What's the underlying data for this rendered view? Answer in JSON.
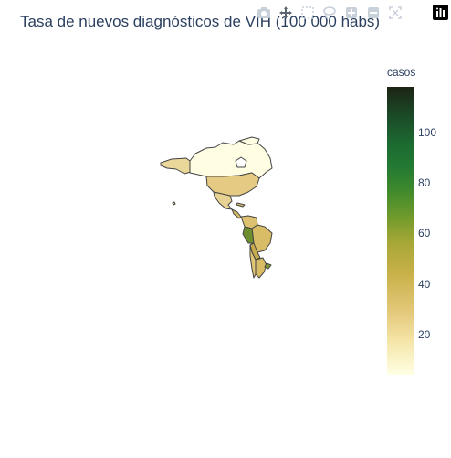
{
  "title": "Tasa de nuevos diagnósticos de VIH (100 000 habs)",
  "colorbar": {
    "title": "casos",
    "ticks": [
      "100",
      "80",
      "60",
      "40",
      "20"
    ],
    "tick_values": [
      100,
      80,
      60,
      40,
      20
    ],
    "range": [
      4,
      118
    ]
  },
  "modebar": {
    "icons": [
      "camera-icon",
      "pan-icon",
      "box-select-icon",
      "lasso-icon",
      "zoom-in-icon",
      "zoom-out-icon",
      "autoscale-icon",
      "plotly-logo-icon"
    ]
  },
  "colors": {
    "low": "#ffffe5",
    "mid": "#c9b14a",
    "high": "#1c2415",
    "border": "#444444"
  }
}
